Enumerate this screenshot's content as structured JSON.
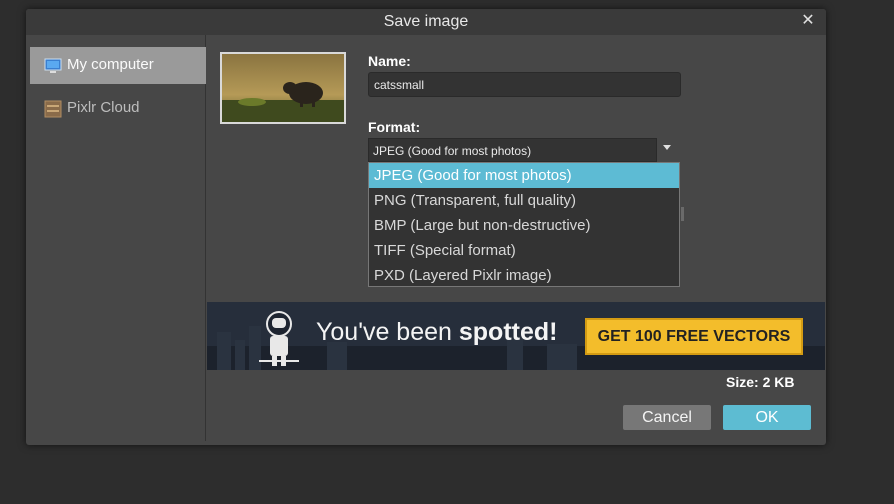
{
  "dialog": {
    "title": "Save image",
    "close_icon": "close-icon"
  },
  "sidebar": {
    "items": [
      {
        "label": "My computer",
        "icon": "computer-icon",
        "active": true
      },
      {
        "label": "Pixlr Cloud",
        "icon": "cloud-storage-icon",
        "active": false
      }
    ]
  },
  "form": {
    "name_label": "Name:",
    "name_value": "catssmall",
    "format_label": "Format:",
    "format_selected": "JPEG (Good for most photos)",
    "format_options": [
      "JPEG (Good for most photos)",
      "PNG (Transparent, full quality)",
      "BMP (Large but non-destructive)",
      "TIFF (Special format)",
      "PXD (Layered Pixlr image)"
    ],
    "size_label": "Size: 2 KB"
  },
  "banner": {
    "text_plain": "You've been ",
    "text_bold": "spotted!",
    "button_label": "GET 100 FREE VECTORS"
  },
  "buttons": {
    "cancel": "Cancel",
    "ok": "OK"
  },
  "colors": {
    "accent": "#5dbcd2",
    "banner_button": "#f3bd2b"
  }
}
